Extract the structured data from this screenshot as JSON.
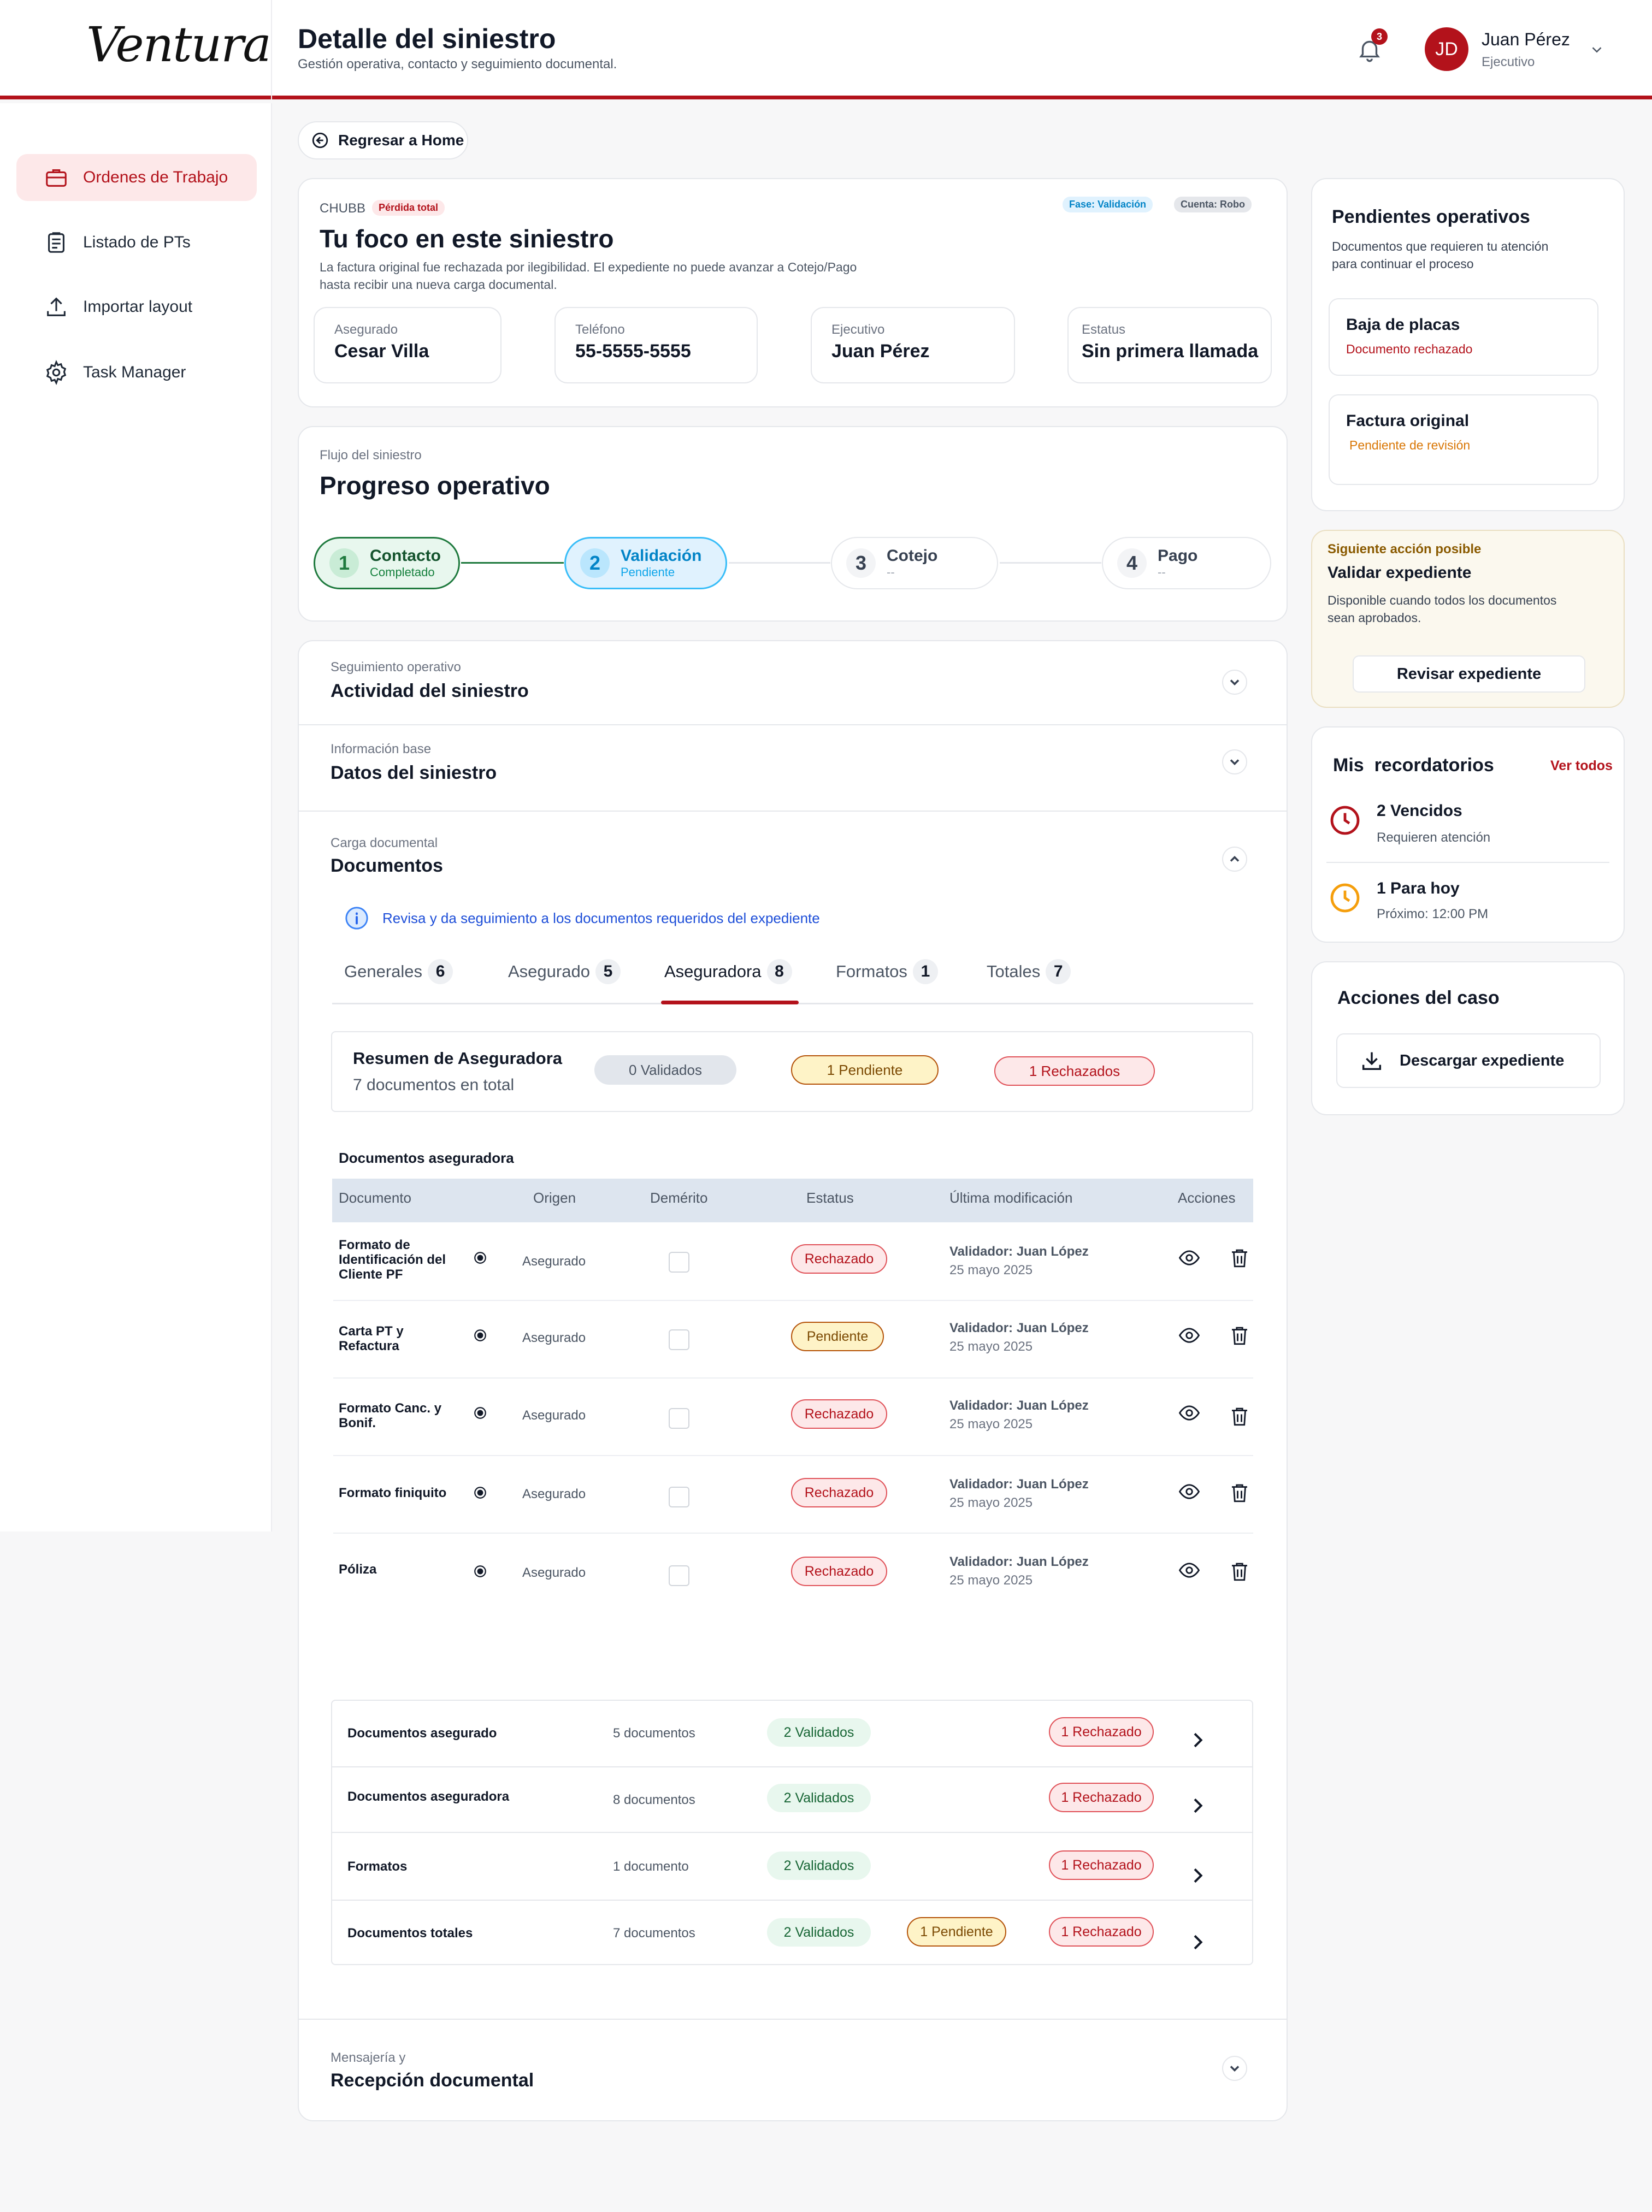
{
  "header": {
    "logo": "Ventura",
    "title": "Detalle del siniestro",
    "subtitle": "Gestión operativa, contacto y seguimiento documental.",
    "notifications": "3",
    "user_initials": "JD",
    "user_name": "Juan Pérez",
    "user_role": "Ejecutivo"
  },
  "sidebar": {
    "items": [
      {
        "label": "Ordenes de Trabajo",
        "icon": "briefcase-icon",
        "active": true
      },
      {
        "label": "Listado de PTs",
        "icon": "clipboard-icon"
      },
      {
        "label": "Importar layout",
        "icon": "upload-icon"
      },
      {
        "label": "Task Manager",
        "icon": "gear-icon"
      }
    ]
  },
  "back_label": "Regresar a Home",
  "focus": {
    "insurer": "CHUBB",
    "loss_tag": "Pérdida total",
    "phase_tag": "Fase: Validación",
    "account_tag": "Cuenta: Robo",
    "title": "Tu foco en este siniestro",
    "description_1": "La factura original fue rechazada por ilegibilidad. El expediente no puede avanzar a Cotejo/Pago",
    "description_2": "hasta recibir una nueva carga documental.",
    "fields": [
      {
        "label": "Asegurado",
        "value": "Cesar Villa"
      },
      {
        "label": "Teléfono",
        "value": "55-5555-5555"
      },
      {
        "label": "Ejecutivo",
        "value": "Juan Pérez"
      },
      {
        "label": "Estatus",
        "value": "Sin primera llamada"
      }
    ]
  },
  "flow": {
    "sub": "Flujo del siniestro",
    "title": "Progreso operativo",
    "steps": [
      {
        "num": "1",
        "title": "Contacto",
        "status": "Completado"
      },
      {
        "num": "2",
        "title": "Validación",
        "status": "Pendiente"
      },
      {
        "num": "3",
        "title": "Cotejo",
        "status": "--"
      },
      {
        "num": "4",
        "title": "Pago",
        "status": "--"
      }
    ]
  },
  "sections": {
    "activity": {
      "sub": "Seguimiento operativo",
      "title": "Actividad del siniestro"
    },
    "data": {
      "sub": "Información base",
      "title": "Datos del siniestro"
    },
    "docs": {
      "sub": "Carga documental",
      "title": "Documentos"
    },
    "messaging": {
      "sub": "Mensajería y",
      "title": "Recepción documental"
    }
  },
  "docs": {
    "info": "Revisa y da seguimiento a los documentos requeridos del expediente",
    "tabs": [
      {
        "label": "Generales",
        "count": "6"
      },
      {
        "label": "Asegurado",
        "count": "5"
      },
      {
        "label": "Aseguradora",
        "count": "8",
        "active": true
      },
      {
        "label": "Formatos",
        "count": "1"
      },
      {
        "label": "Totales",
        "count": "7"
      }
    ],
    "summary": {
      "title": "Resumen de Aseguradora",
      "subtitle": "7 documentos en total",
      "validated": "0 Validados",
      "pending": "1 Pendiente",
      "rejected": "1 Rechazados"
    },
    "table_title": "Documentos aseguradora",
    "columns": [
      "Documento",
      "Origen",
      "Demérito",
      "Estatus",
      "Última modificación",
      "Acciones"
    ],
    "rows": [
      {
        "doc_1": "Formato de",
        "doc_2": "Identificación del",
        "doc_3": "Cliente PF",
        "origin": "Asegurado",
        "status": "Rechazado",
        "validator": "Validador: Juan López",
        "date": "25 mayo 2025"
      },
      {
        "doc_1": "Carta PT y",
        "doc_2": "Refactura",
        "origin": "Asegurado",
        "status": "Pendiente",
        "validator": "Validador: Juan López",
        "date": "25 mayo 2025"
      },
      {
        "doc_1": "Formato Canc. y",
        "doc_2": "Bonif.",
        "origin": "Asegurado",
        "status": "Rechazado",
        "validator": "Validador: Juan López",
        "date": "25 mayo 2025"
      },
      {
        "doc_1": "Formato finiquito",
        "origin": "Asegurado",
        "status": "Rechazado",
        "validator": "Validador: Juan López",
        "date": "25 mayo 2025"
      },
      {
        "doc_1": "Póliza",
        "origin": "Asegurado",
        "status": "Rechazado",
        "validator": "Validador: Juan López",
        "date": "25 mayo 2025"
      }
    ],
    "groups": [
      {
        "name": "Documentos asegurado",
        "count": "5 documentos",
        "validated": "2 Validados",
        "pending": "",
        "rejected": "1 Rechazado"
      },
      {
        "name": "Documentos aseguradora",
        "count": "8 documentos",
        "validated": "2 Validados",
        "pending": "",
        "rejected": "1 Rechazado"
      },
      {
        "name": "Formatos",
        "count": "1 documento",
        "validated": "2 Validados",
        "pending": "",
        "rejected": "1 Rechazado"
      },
      {
        "name": "Documentos totales",
        "count": "7 documentos",
        "validated": "2 Validados",
        "pending": "1 Pendiente",
        "rejected": "1 Rechazado"
      }
    ]
  },
  "pending_ops": {
    "title": "Pendientes operativos",
    "desc_1": "Documentos que requieren tu atención",
    "desc_2": "para continuar el proceso",
    "items": [
      {
        "title": "Baja de placas",
        "status": "Documento rechazado"
      },
      {
        "title": "Factura original",
        "status": "Pendiente de revisión"
      }
    ]
  },
  "next_action": {
    "eyebrow": "Siguiente acción posible",
    "title": "Validar expediente",
    "desc_1": "Disponible cuando todos los documentos",
    "desc_2": "sean aprobados.",
    "button": "Revisar expediente"
  },
  "reminders": {
    "title": "Mis  recordatorios",
    "link": "Ver todos",
    "items": [
      {
        "title": "2 Vencidos",
        "sub": "Requieren atención"
      },
      {
        "title": "1 Para hoy",
        "sub": "Próximo: 12:00 PM"
      }
    ]
  },
  "case_actions": {
    "title": "Acciones del caso",
    "download": "Descargar expediente"
  },
  "colors": {
    "brand": "#b3121b",
    "validation": "#0ea5e9",
    "completed": "#16a34a",
    "pending": "#b45309"
  }
}
